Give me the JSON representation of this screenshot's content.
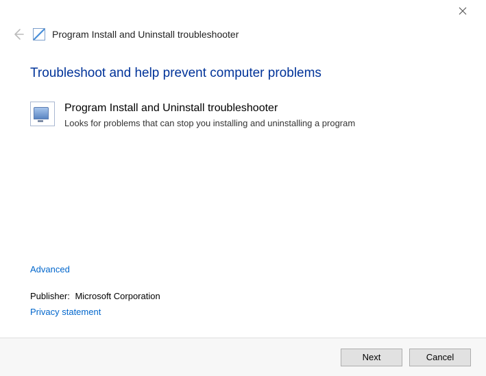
{
  "window": {
    "title": "Program Install and Uninstall troubleshooter"
  },
  "page": {
    "heading": "Troubleshoot and help prevent computer problems"
  },
  "troubleshooter": {
    "title": "Program Install and Uninstall troubleshooter",
    "description": "Looks for problems that can stop you installing and uninstalling a program"
  },
  "links": {
    "advanced": "Advanced",
    "privacy": "Privacy statement"
  },
  "publisher": {
    "label": "Publisher:",
    "value": "Microsoft Corporation"
  },
  "buttons": {
    "next": "Next",
    "cancel": "Cancel"
  }
}
